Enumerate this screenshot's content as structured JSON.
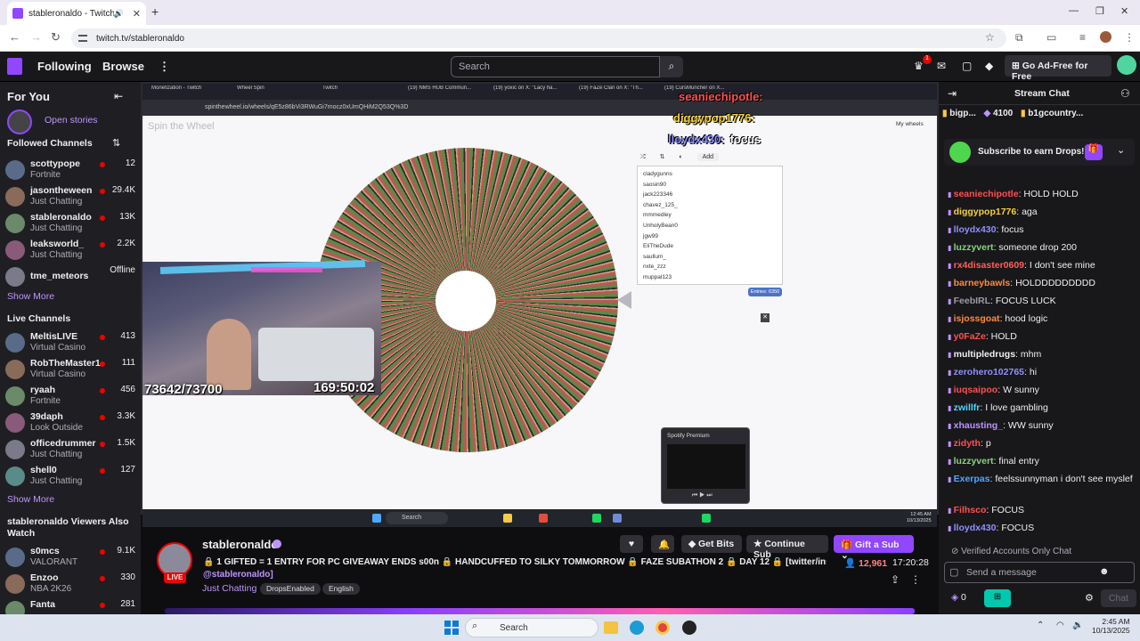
{
  "browser": {
    "tab_title": "stableronaldo - Twitch",
    "url": "twitch.tv/stableronaldo"
  },
  "twitch_nav": {
    "following": "Following",
    "browse": "Browse",
    "search_placeholder": "Search",
    "notif_count": "1",
    "ad_free": "Go Ad-Free for Free"
  },
  "sidebar": {
    "for_you": "For You",
    "open_stories": "Open stories",
    "followed_header": "Followed Channels",
    "followed": [
      {
        "name": "scottypope",
        "category": "Fortnite",
        "viewers": "12"
      },
      {
        "name": "jasontheween",
        "category": "Just Chatting",
        "viewers": "29.4K"
      },
      {
        "name": "stableronaldo",
        "category": "Just Chatting",
        "viewers": "13K"
      },
      {
        "name": "leaksworld_",
        "category": "Just Chatting",
        "viewers": "2.2K"
      },
      {
        "name": "tme_meteors",
        "category": "",
        "viewers": "Offline"
      }
    ],
    "show_more": "Show More",
    "live_header": "Live Channels",
    "live": [
      {
        "name": "MeltisLIVE",
        "category": "Virtual Casino",
        "viewers": "413"
      },
      {
        "name": "RobTheMaster1",
        "category": "Virtual Casino",
        "viewers": "111"
      },
      {
        "name": "ryaah",
        "category": "Fortnite",
        "viewers": "456"
      },
      {
        "name": "39daph",
        "category": "Look Outside",
        "viewers": "3.3K"
      },
      {
        "name": "officedrummer",
        "category": "Just Chatting",
        "viewers": "1.5K"
      },
      {
        "name": "shell0",
        "category": "Just Chatting",
        "viewers": "127"
      }
    ],
    "show_more2": "Show More",
    "also_watch_header": "stableronaldo Viewers Also Watch",
    "also": [
      {
        "name": "s0mcs",
        "category": "VALORANT",
        "viewers": "9.1K"
      },
      {
        "name": "Enzoo",
        "category": "NBA 2K26",
        "viewers": "330"
      },
      {
        "name": "Fanta",
        "category": "",
        "viewers": "281"
      }
    ]
  },
  "video": {
    "inner_tabs": [
      "Monetization - Twitch",
      "Wheel Spin",
      "Twitch",
      "(19) NMS HUB Commun...",
      "(19) yoxic on X: \"Lacy ha...",
      "(19) FaZe Clan on X: \"Th...",
      "(19) CursMuncher on X..."
    ],
    "inner_url": "spinthewheel.io/wheels/qE5z86bVi3RWuGi7mocz0xUmQHiM2Q53Q%3D",
    "spin_logo": "Spin the Wheel",
    "entries": [
      "cladygunns",
      "saosin90",
      "jack223346",
      "chavez_125_",
      "mmmedley",
      "UnholyBean0",
      "jgw99",
      "EliTheDude",
      "saullum_",
      "nxte_zzz",
      "muppal123"
    ],
    "add_label": "Add",
    "entries_count": "Entries: 6350",
    "my_wheels": "My wheels",
    "counter": "73642/73700",
    "timer": "169:50:02",
    "overlay_chat": [
      {
        "user": "seaniechipotle:",
        "color": "#ff4f4f"
      },
      {
        "user": "diggypop1776:",
        "color": "#f7d034"
      },
      {
        "user": "lloydx430:",
        "msg": "focus",
        "color": "#8f8fff"
      }
    ],
    "spotify_label": "Spotify Premium",
    "win_search": "Search",
    "win_clock_time": "12:45 AM",
    "win_clock_date": "10/13/2025"
  },
  "stream": {
    "streamer": "stableronaldo",
    "live": "LIVE",
    "title_line1": "🔒 1 GIFTED = 1 ENTRY FOR PC GIVEAWAY ENDS s00n 🔒 HANDCUFFED TO SILKY TOMMORROW 🔒 FAZE SUBATHON 2 🔒 DAY 12 🔒 [twitter/insta",
    "title_line2": "@stableronaldo]",
    "category": "Just Chatting",
    "tags": [
      "DropsEnabled",
      "English"
    ],
    "get_bits": "Get Bits",
    "continue_sub": "Continue Sub",
    "gift_sub": "Gift a Sub",
    "viewers": "12,961",
    "uptime": "17:20:28"
  },
  "chat": {
    "header": "Stream Chat",
    "pinned": [
      {
        "name": "bigp...",
        "count": "4100"
      },
      {
        "name": "b1gcountry..."
      }
    ],
    "subscribe_drops": "Subscribe to earn Drops!",
    "messages": [
      {
        "user": "seaniechipotle",
        "text": "HOLD HOLD",
        "color": "#ff4f4f"
      },
      {
        "user": "diggypop1776",
        "text": "aga",
        "color": "#f7d034"
      },
      {
        "user": "lloydx430",
        "text": "focus",
        "color": "#8f8fff"
      },
      {
        "user": "luzzyvert",
        "text": "someone drop 200",
        "color": "#8ad27c"
      },
      {
        "user": "rx4disaster0609",
        "text": "I don't see mine",
        "color": "#ff5f5f"
      },
      {
        "user": "barneybawls",
        "text": "HOLDDDDDDDDD",
        "color": "#ff8a3d"
      },
      {
        "user": "FeebIRL",
        "text": "FOCUS LUCK",
        "color": "#9a9aa4"
      },
      {
        "user": "isjossgoat",
        "text": "hood logic",
        "color": "#ff8a3d"
      },
      {
        "user": "y0FaZe",
        "text": "HOLD",
        "color": "#ff4f4f"
      },
      {
        "user": "multipledrugs",
        "text": "mhm",
        "color": "#efeff1"
      },
      {
        "user": "zerohero102765",
        "text": "hi",
        "color": "#8f8fff"
      },
      {
        "user": "iuqsaipoo",
        "text": "W sunny",
        "color": "#ff4f4f"
      },
      {
        "user": "zwillfr",
        "text": "I love gambling",
        "color": "#4fd6ff"
      },
      {
        "user": "xhausting_",
        "text": "WW sunny",
        "color": "#bf94ff"
      },
      {
        "user": "zidyth",
        "text": "p",
        "color": "#ff4f4f"
      },
      {
        "user": "luzzyvert",
        "text": "final entry",
        "color": "#8ad27c"
      },
      {
        "user": "Exerpas",
        "text": "feelssunnyman i don't see myslef",
        "color": "#4fa8ff"
      },
      {
        "user": "Filhsco",
        "text": "FOCUS",
        "color": "#ff4f4f"
      },
      {
        "user": "lloydx430",
        "text": "FOCUS",
        "color": "#8f8fff"
      }
    ],
    "verified_only": "Verified Accounts Only Chat",
    "send_placeholder": "Send a message",
    "points": "0",
    "chat_button": "Chat"
  },
  "os": {
    "search": "Search",
    "time": "2:45 AM",
    "date": "10/13/2025"
  }
}
